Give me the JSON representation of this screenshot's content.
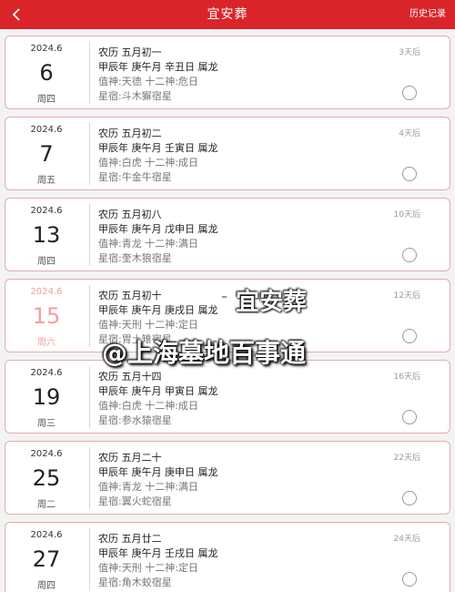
{
  "header": {
    "title": "宜安葬",
    "history_label": "历史记录"
  },
  "days": [
    {
      "ym": "2024.6",
      "day": "6",
      "week": "周四",
      "lunar": "农历 五月初一",
      "ganzhi": "甲辰年 庚午月 辛丑日 属龙",
      "zhishen": "值神:天德   十二神:危日",
      "xingxiu": "星宿:斗木獬宿星",
      "countdown": "3天后",
      "weekend": false
    },
    {
      "ym": "2024.6",
      "day": "7",
      "week": "周五",
      "lunar": "农历 五月初二",
      "ganzhi": "甲辰年 庚午月 壬寅日 属龙",
      "zhishen": "值神:白虎   十二神:成日",
      "xingxiu": "星宿:牛金牛宿星",
      "countdown": "4天后",
      "weekend": false
    },
    {
      "ym": "2024.6",
      "day": "13",
      "week": "周四",
      "lunar": "农历 五月初八",
      "ganzhi": "甲辰年 庚午月 戊申日 属龙",
      "zhishen": "值神:青龙   十二神:满日",
      "xingxiu": "星宿:奎木狼宿星",
      "countdown": "10天后",
      "weekend": false
    },
    {
      "ym": "2024.6",
      "day": "15",
      "week": "周六",
      "lunar": "农历 五月初十",
      "ganzhi": "甲辰年 庚午月 庚戌日 属龙",
      "zhishen": "值神:天刑   十二神:定日",
      "xingxiu": "星宿:胃土雉宿星",
      "countdown": "12天后",
      "weekend": true
    },
    {
      "ym": "2024.6",
      "day": "19",
      "week": "周三",
      "lunar": "农历 五月十四",
      "ganzhi": "甲辰年 庚午月 甲寅日 属龙",
      "zhishen": "值神:白虎   十二神:成日",
      "xingxiu": "星宿:参水猿宿星",
      "countdown": "16天后",
      "weekend": false
    },
    {
      "ym": "2024.6",
      "day": "25",
      "week": "周二",
      "lunar": "农历 五月二十",
      "ganzhi": "甲辰年 庚午月 庚申日 属龙",
      "zhishen": "值神:青龙   十二神:满日",
      "xingxiu": "星宿:翼火蛇宿星",
      "countdown": "22天后",
      "weekend": false
    },
    {
      "ym": "2024.6",
      "day": "27",
      "week": "周四",
      "lunar": "农历 五月廿二",
      "ganzhi": "甲辰年 庚午月 壬戌日 属龙",
      "zhishen": "值神:天刑   十二神:定日",
      "xingxiu": "星宿:角木蛟宿星",
      "countdown": "24天后",
      "weekend": false
    }
  ],
  "overlay": {
    "dash": "–",
    "title": "宜安葬",
    "subtitle": "@上海墓地百事通"
  },
  "icons": {
    "back": "chevron-left-icon",
    "check": "radio-circle-icon"
  },
  "colors": {
    "header_bg": "#d9252a",
    "card_border": "#e7aaaa",
    "weekend_text": "#f0a0a0"
  }
}
